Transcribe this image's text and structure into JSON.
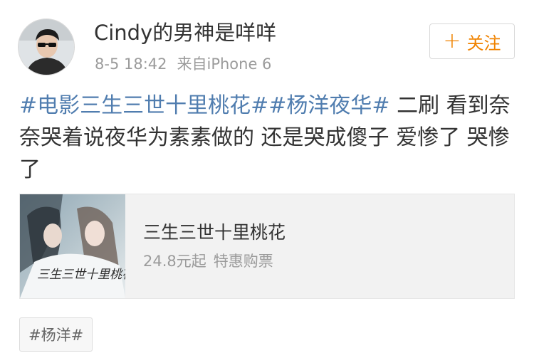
{
  "post": {
    "username": "Cindy的男神是咩咩",
    "time": "8-5 18:42",
    "source": "来自iPhone 6",
    "follow_label": "关注",
    "text": {
      "topic1": "#电影三生三世十里桃花#",
      "topic2": "#杨洋夜华#",
      "body": " 二刷 看到奈奈哭着说夜华为素素做的 还是哭成傻子 爱惨了 哭惨了"
    },
    "card": {
      "title": "三生三世十里桃花",
      "price": "24.8元起",
      "promo": "特惠购票",
      "poster_text": "三生三世十里桃花"
    },
    "tag": "#杨洋#"
  },
  "colors": {
    "topic": "#507daf",
    "follow": "#f08300",
    "meta": "#9b9b9b"
  },
  "icons": {
    "follow": "plus-icon"
  }
}
